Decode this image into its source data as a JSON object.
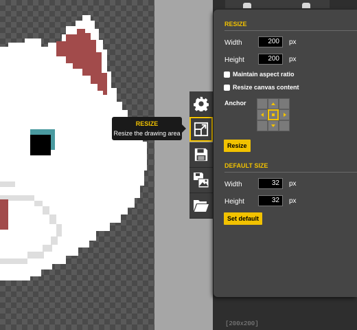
{
  "tooltip": {
    "title": "RESIZE",
    "description": "Resize the drawing area"
  },
  "tools": [
    {
      "name": "settings",
      "icon": "gear-icon"
    },
    {
      "name": "resize",
      "icon": "resize-icon",
      "active": true
    },
    {
      "name": "save",
      "icon": "floppy-disk-icon"
    },
    {
      "name": "export-image",
      "icon": "save-image-icon"
    },
    {
      "name": "open",
      "icon": "folder-icon"
    }
  ],
  "resize": {
    "title": "RESIZE",
    "width_label": "Width",
    "width_value": "200",
    "height_label": "Height",
    "height_value": "200",
    "unit": "px",
    "maintain_label": "Maintain aspect ratio",
    "resize_content_label": "Resize canvas content",
    "anchor_label": "Anchor",
    "button": "Resize"
  },
  "default_size": {
    "title": "DEFAULT SIZE",
    "width_label": "Width",
    "width_value": "32",
    "height_label": "Height",
    "height_value": "32",
    "unit": "px",
    "button": "Set default"
  },
  "status": "[200x200]",
  "colors": {
    "accent": "#f2c200",
    "panel": "#454545"
  }
}
